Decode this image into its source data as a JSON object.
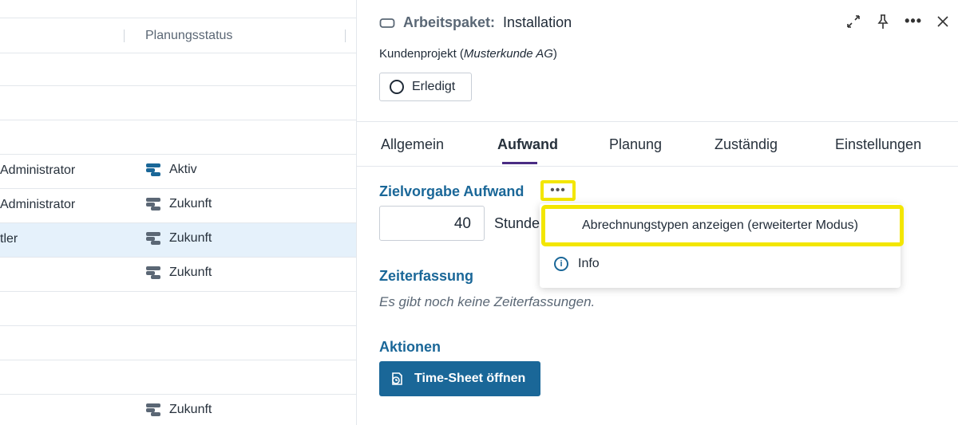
{
  "table": {
    "header": {
      "status_label": "Planungsstatus"
    },
    "rows": [
      {
        "name": "",
        "status": ""
      },
      {
        "name": "",
        "status": ""
      },
      {
        "name": "",
        "status": ""
      },
      {
        "name": "Administrator",
        "status": "Aktiv"
      },
      {
        "name": "Administrator",
        "status": "Zukunft"
      },
      {
        "name": "tler",
        "status": "Zukunft"
      },
      {
        "name": "",
        "status": "Zukunft"
      },
      {
        "name": "",
        "status": ""
      },
      {
        "name": "",
        "status": ""
      },
      {
        "name": "",
        "status": ""
      },
      {
        "name": "",
        "status": "Zukunft"
      }
    ]
  },
  "panel": {
    "title_type": "Arbeitspaket:",
    "title_name": "Installation",
    "project_prefix": "Kundenprojekt (",
    "project_customer": "Musterkunde AG",
    "project_suffix": ")",
    "done_label": "Erledigt",
    "tabs": [
      "Allgemein",
      "Aufwand",
      "Planung",
      "Zuständig",
      "Einstellungen"
    ],
    "active_tab": "Aufwand",
    "target_effort": {
      "heading": "Zielvorgabe Aufwand",
      "more_label": "•••",
      "value": "40",
      "unit": "Stunde"
    },
    "time_tracking": {
      "heading": "Zeiterfassung",
      "empty_text": "Es gibt noch keine Zeiterfassungen."
    },
    "actions": {
      "heading": "Aktionen",
      "timesheet_label": "Time-Sheet öffnen"
    }
  },
  "menu": {
    "items": [
      {
        "label": "Abrechnungstypen anzeigen (erweiterter Modus)"
      },
      {
        "label": "Info",
        "icon": "info-icon"
      }
    ]
  },
  "colors": {
    "accent": "#1a6798",
    "highlight": "#f3e600",
    "selected_row": "#e5f1fb",
    "tab_underline": "#4a2c84"
  }
}
